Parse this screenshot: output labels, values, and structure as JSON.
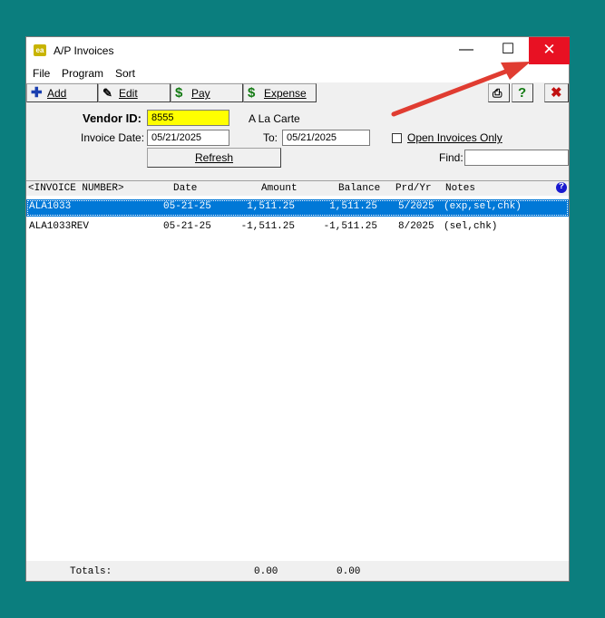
{
  "window": {
    "title": "A/P Invoices",
    "app_icon": "ea",
    "minimize_icon": "minimize-icon",
    "maximize_icon": "maximize-icon",
    "close_icon": "close-icon"
  },
  "menu": [
    "File",
    "Program",
    "Sort"
  ],
  "toolbar": {
    "add": "Add",
    "edit": "Edit",
    "pay": "Pay",
    "expense": "Expense"
  },
  "form": {
    "vendor_label": "Vendor ID:",
    "vendor_id": "8555",
    "vendor_name": "A La Carte",
    "invoice_date_label": "Invoice Date:",
    "invoice_date_from": "05/21/2025",
    "to_label": "To:",
    "invoice_date_to": "05/21/2025",
    "open_only_label": "Open Invoices Only",
    "open_only_checked": false,
    "find_label": "Find:",
    "find_value": "",
    "refresh_label": "Refresh"
  },
  "list": {
    "headers": {
      "invoice": "<INVOICE NUMBER>",
      "date": "Date",
      "amount": "Amount",
      "balance": "Balance",
      "prdyr": "Prd/Yr",
      "notes": "Notes"
    },
    "rows": [
      {
        "invoice": "ALA1033",
        "date": "05-21-25",
        "amount": "1,511.25",
        "balance": "1,511.25",
        "prdyr": "5/2025",
        "notes": "(exp,sel,chk)",
        "selected": true
      },
      {
        "invoice": "ALA1033REV",
        "date": "05-21-25",
        "amount": "-1,511.25",
        "balance": "-1,511.25",
        "prdyr": "8/2025",
        "notes": "(sel,chk)",
        "selected": false
      }
    ]
  },
  "totals": {
    "label": "Totals:",
    "amount": "0.00",
    "balance": "0.00"
  },
  "colors": {
    "desktop": "#0b7e7e",
    "selection": "#0078d7",
    "close": "#e81123",
    "arrow": "#e03c31",
    "vendor_field": "#ffff00"
  }
}
